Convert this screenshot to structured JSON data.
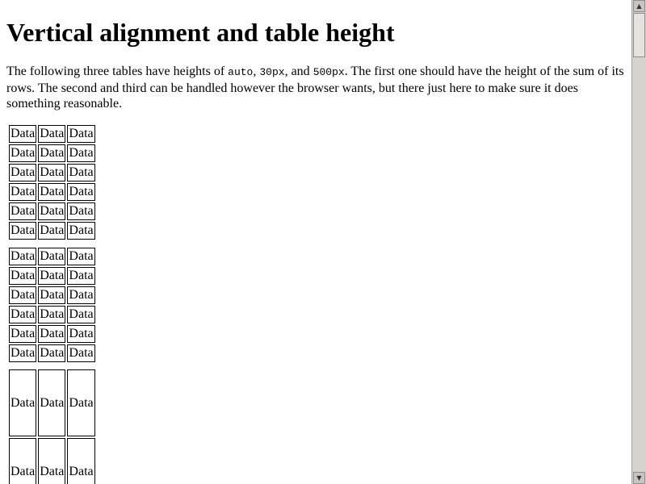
{
  "page": {
    "title": "Vertical alignment and table height",
    "intro": {
      "before": "The following three tables have heights of ",
      "code1": "auto",
      "sep1": ", ",
      "code2": "30px",
      "sep2": ", and ",
      "code3": "500px",
      "after": ". The first one should have the height of the sum of its rows. The second and third can be handled however the browser wants, but there just here to make sure it does something reasonable."
    }
  },
  "tables": [
    {
      "label": "table-auto",
      "rows": 6,
      "cols": 3,
      "cell_text": "Data"
    },
    {
      "label": "table-30px",
      "rows": 6,
      "cols": 3,
      "cell_text": "Data"
    },
    {
      "label": "table-500px",
      "rows": 2,
      "cols": 3,
      "cell_text": "Data"
    }
  ],
  "scrollbar": {
    "up_icon": "arrow-up-icon",
    "down_icon": "arrow-down-icon"
  }
}
